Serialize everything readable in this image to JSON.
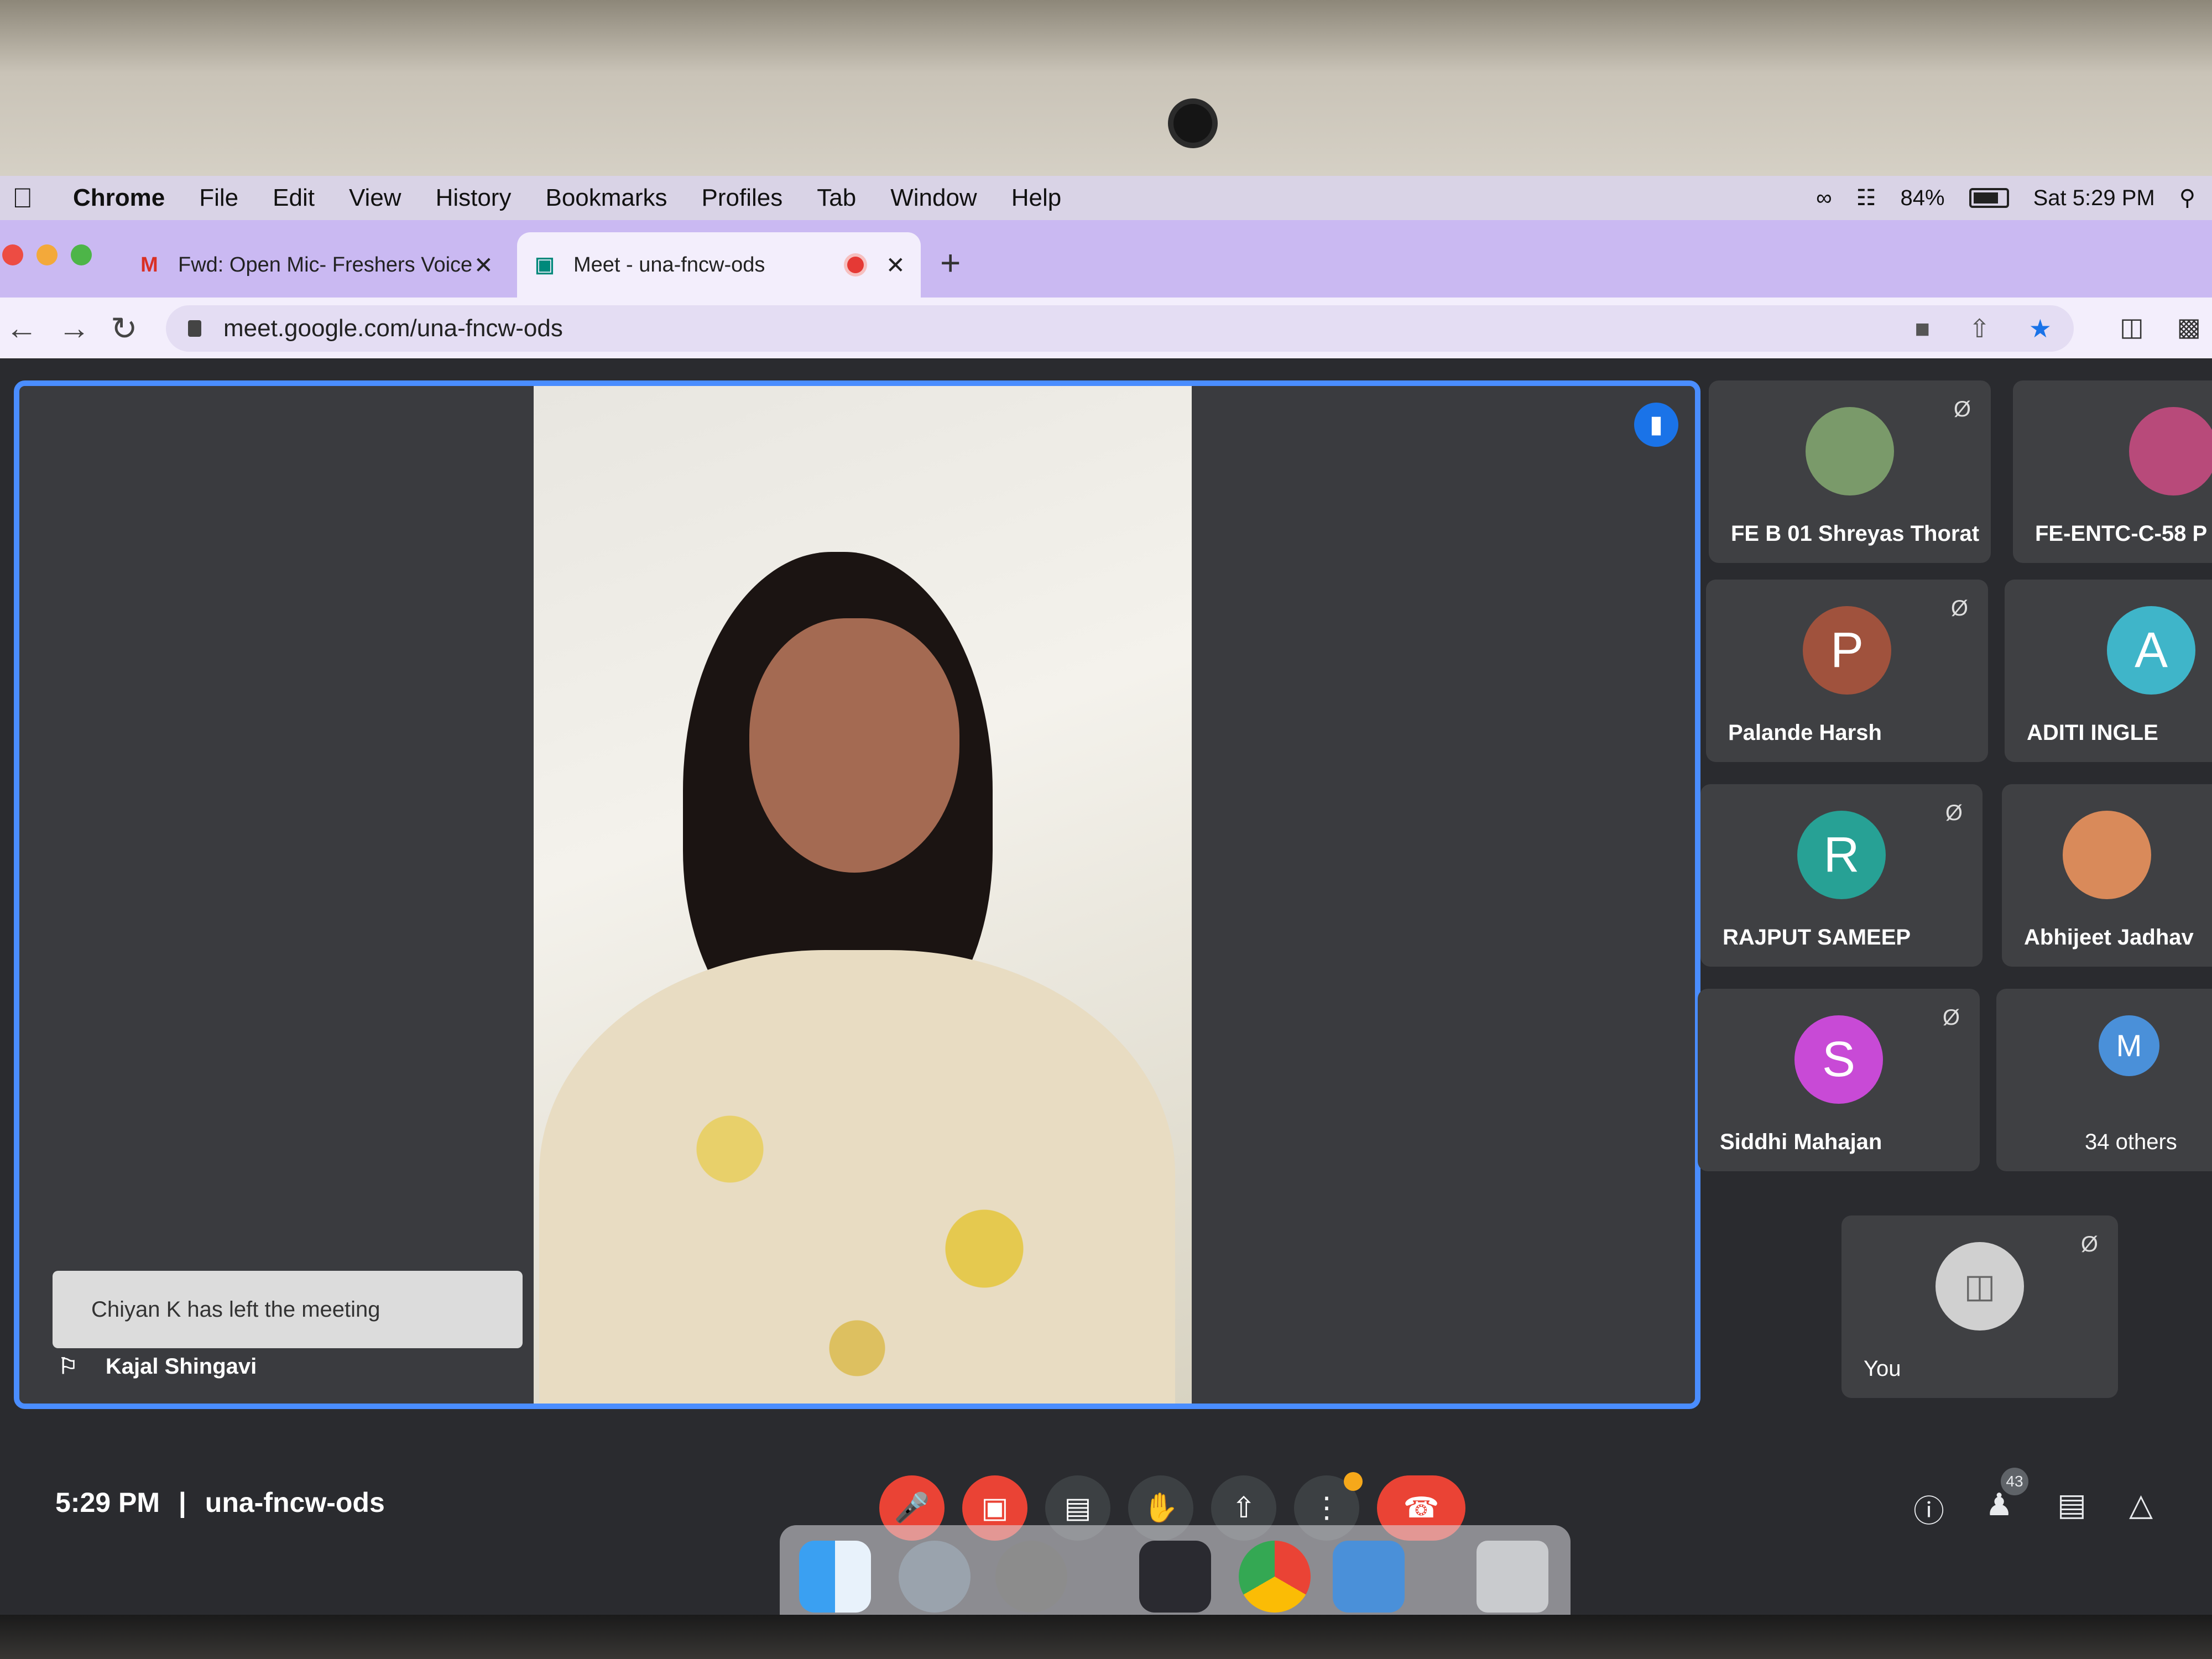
{
  "menubar": {
    "app_name": "Chrome",
    "menus": [
      "File",
      "Edit",
      "View",
      "History",
      "Bookmarks",
      "Profiles",
      "Tab",
      "Window",
      "Help"
    ],
    "battery": "84%",
    "datetime": "Sat 5:29 PM"
  },
  "tabs": [
    {
      "title": "Fwd: Open Mic- Freshers Voice",
      "icon": "gmail-icon"
    },
    {
      "title": "Meet - una-fncw-ods",
      "icon": "meet-icon",
      "recording": true
    }
  ],
  "url": "meet.google.com/una-fncw-ods",
  "stage": {
    "toast": "Chiyan K has left the meeting",
    "speaker_name": "Kajal Shingavi"
  },
  "tiles": [
    {
      "name": "FE B 01 Shreyas Thorat",
      "initial": "",
      "color": "#7a9a6a",
      "muted": true
    },
    {
      "name": "FE-ENTC-C-58 P",
      "initial": "",
      "color": "#b84a7a",
      "muted": false
    },
    {
      "name": "Palande Harsh",
      "initial": "P",
      "color": "#a0523d",
      "muted": true
    },
    {
      "name": "ADITI INGLE",
      "initial": "A",
      "color": "#3fb5c9",
      "muted": false
    },
    {
      "name": "RAJPUT SAMEEP",
      "initial": "R",
      "color": "#27a195",
      "muted": true
    },
    {
      "name": "Abhijeet Jadhav",
      "initial": "",
      "color": "#d98a5a",
      "muted": false
    },
    {
      "name": "Siddhi Mahajan",
      "initial": "S",
      "color": "#c84ad6",
      "muted": true
    },
    {
      "name": "34 others",
      "initial": "M",
      "color": "#4a90d9",
      "muted": false
    },
    {
      "name": "You",
      "initial": "",
      "color": "#d0d0d0",
      "muted": true
    }
  ],
  "meetbar": {
    "time": "5:29 PM",
    "meeting_code": "una-fncw-ods",
    "participants_count": "43"
  }
}
